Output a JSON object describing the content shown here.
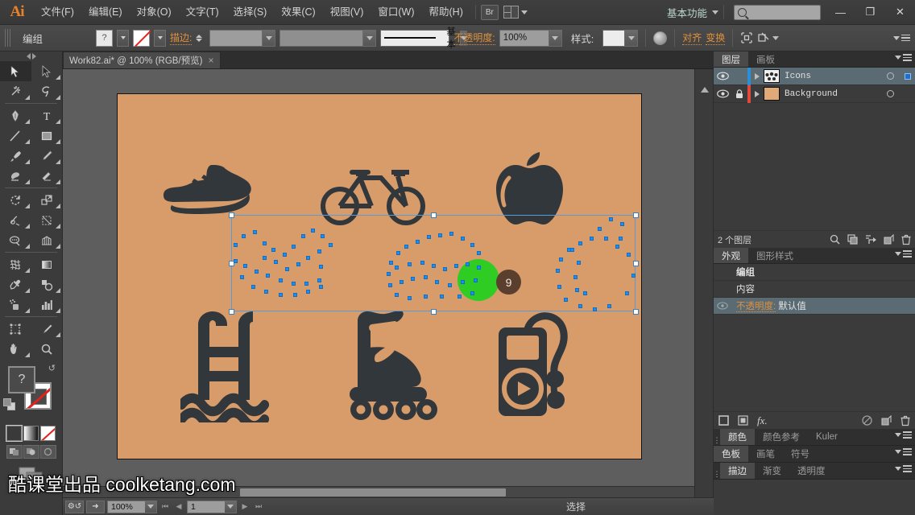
{
  "app": {
    "logo": "Ai"
  },
  "menubar": {
    "items": [
      {
        "label": "文件(F)"
      },
      {
        "label": "编辑(E)"
      },
      {
        "label": "对象(O)"
      },
      {
        "label": "文字(T)"
      },
      {
        "label": "选择(S)"
      },
      {
        "label": "效果(C)"
      },
      {
        "label": "视图(V)"
      },
      {
        "label": "窗口(W)"
      },
      {
        "label": "帮助(H)"
      }
    ],
    "bridge_label": "Br",
    "workspace": "基本功能",
    "search_placeholder": "",
    "window_buttons": {
      "minimize": "—",
      "maximize": "❐",
      "close": "✕"
    }
  },
  "controlbar": {
    "selection_label": "编组",
    "fill_swatch": "?",
    "stroke_label": "描边:",
    "stroke_weight": "",
    "profile": "",
    "brush_label": "基本",
    "opacity_label": "不透明度:",
    "opacity_value": "100%",
    "style_label": "样式:",
    "align_label": "对齐",
    "transform_label": "变换"
  },
  "tabbar": {
    "document": "Work82.ai* @ 100% (RGB/预览)",
    "close": "×"
  },
  "toolbox": {
    "tools": [
      {
        "name": "selection-tool",
        "active": true
      },
      {
        "name": "direct-selection-tool",
        "active": false
      },
      {
        "name": "magic-wand-tool",
        "active": false
      },
      {
        "name": "lasso-tool",
        "active": false
      },
      {
        "name": "pen-tool",
        "active": false
      },
      {
        "name": "type-tool",
        "active": false
      },
      {
        "name": "line-segment-tool",
        "active": false
      },
      {
        "name": "rectangle-tool",
        "active": false
      },
      {
        "name": "paintbrush-tool",
        "active": false
      },
      {
        "name": "pencil-tool",
        "active": false
      },
      {
        "name": "blob-brush-tool",
        "active": false
      },
      {
        "name": "eraser-tool",
        "active": false
      },
      {
        "name": "rotate-tool",
        "active": false
      },
      {
        "name": "scale-tool",
        "active": false
      },
      {
        "name": "width-tool",
        "active": false
      },
      {
        "name": "free-transform-tool",
        "active": false
      },
      {
        "name": "shape-builder-tool",
        "active": false
      },
      {
        "name": "perspective-grid-tool",
        "active": false
      },
      {
        "name": "mesh-tool",
        "active": false
      },
      {
        "name": "gradient-tool",
        "active": false
      },
      {
        "name": "eyedropper-tool",
        "active": false
      },
      {
        "name": "blend-tool",
        "active": false
      },
      {
        "name": "symbol-sprayer-tool",
        "active": false
      },
      {
        "name": "column-graph-tool",
        "active": false
      },
      {
        "name": "artboard-tool",
        "active": false
      },
      {
        "name": "slice-tool",
        "active": false
      },
      {
        "name": "hand-tool",
        "active": false
      },
      {
        "name": "zoom-tool",
        "active": false
      }
    ],
    "fill_label": "?",
    "colors": {
      "fill": "#4a4a4a",
      "stroke": "none"
    }
  },
  "canvas": {
    "artboard_color": "#d89c6a",
    "canvas_color": "#5e5e5e",
    "icon_color": "#3a3a3a",
    "selection_color": "#5b9bd5",
    "anchor_color": "#1e8cf0",
    "badge": {
      "circle_color": "#2fcc23",
      "badge_color": "#5b3f2e",
      "badge_text": "9"
    },
    "icons": [
      {
        "name": "running-shoe-icon",
        "selected": true
      },
      {
        "name": "bicycle-icon",
        "selected": true
      },
      {
        "name": "apple-icon",
        "selected": true
      },
      {
        "name": "swimming-pool-ladder-icon",
        "selected": false
      },
      {
        "name": "roller-skate-icon",
        "selected": false
      },
      {
        "name": "mp3-player-icon",
        "selected": false
      }
    ]
  },
  "statusbar": {
    "zoom": "100%",
    "artboard_number": "1",
    "status_text": "选择"
  },
  "panels": {
    "layers": {
      "tabs": [
        {
          "label": "图层",
          "active": true
        },
        {
          "label": "画板",
          "active": false
        }
      ],
      "rows": [
        {
          "name": "Icons",
          "color": "#2a8fd4",
          "thumb": "#2f2f2f",
          "locked": false,
          "selected": true,
          "targeted": true
        },
        {
          "name": "Background",
          "color": "#e2483c",
          "thumb": "#e0a978",
          "locked": true,
          "selected": false,
          "targeted": false
        }
      ],
      "count_label": "2 个图层"
    },
    "appearance": {
      "tabs": [
        {
          "label": "外观",
          "active": true
        },
        {
          "label": "图形样式",
          "active": false
        }
      ],
      "rows": [
        {
          "label": "编组",
          "type": "head"
        },
        {
          "label": "内容",
          "type": "normal"
        },
        {
          "label": "不透明度:",
          "value": "默认值",
          "type": "opacity"
        }
      ]
    },
    "color_strip": {
      "tabs": [
        {
          "label": "颜色",
          "active": true
        },
        {
          "label": "颜色参考",
          "active": false
        },
        {
          "label": "Kuler",
          "active": false
        }
      ]
    },
    "swatch_strip": {
      "tabs": [
        {
          "label": "色板",
          "active": true
        },
        {
          "label": "画笔",
          "active": false
        },
        {
          "label": "符号",
          "active": false
        }
      ]
    },
    "stroke_strip": {
      "tabs": [
        {
          "label": "描边",
          "active": true
        },
        {
          "label": "渐变",
          "active": false
        },
        {
          "label": "透明度",
          "active": false
        }
      ]
    }
  },
  "watermark": {
    "cn": "酷课堂出品",
    "en": "coolketang.com"
  }
}
